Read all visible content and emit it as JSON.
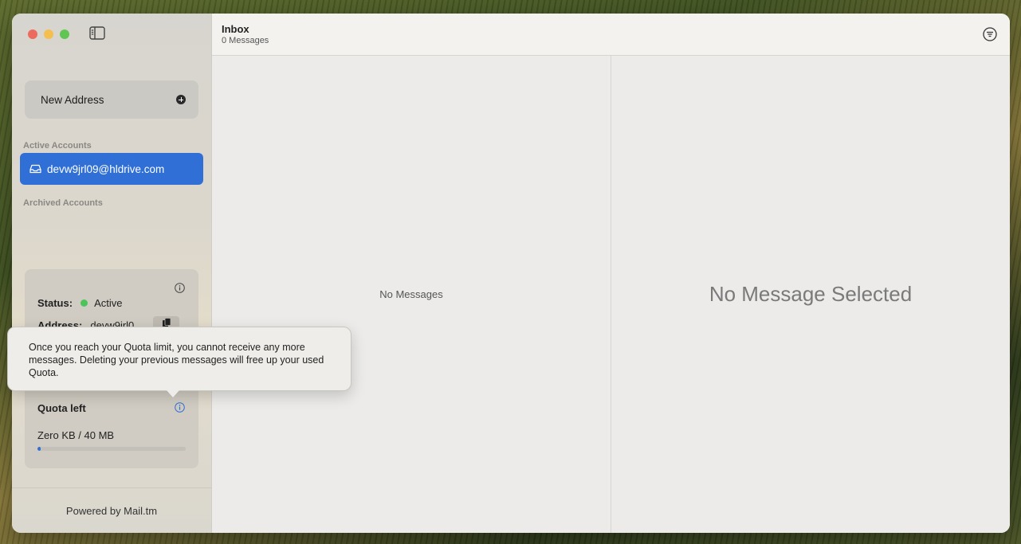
{
  "toolbar": {
    "title": "Inbox",
    "subtitle": "0 Messages"
  },
  "sidebar": {
    "new_address_label": "New Address",
    "active_section": "Active Accounts",
    "archived_section": "Archived Accounts",
    "accounts": [
      {
        "email": "devw9jrl09@hldrive.com",
        "selected": true
      }
    ],
    "footer": "Powered by Mail.tm"
  },
  "status_card": {
    "status_label": "Status:",
    "status_value": "Active",
    "address_label": "Address:",
    "address_value": "devw9jrl0",
    "quota_label": "Quota left",
    "quota_value": "Zero KB / 40 MB",
    "quota_used_fraction": 0.02
  },
  "tooltip": {
    "text": "Once you reach your Quota limit, you cannot receive any more messages. Deleting your previous messages will free up your used Quota."
  },
  "list_pane": {
    "empty_text": "No Messages"
  },
  "detail_pane": {
    "empty_text": "No Message Selected"
  },
  "colors": {
    "accent": "#2f6fd6",
    "status_active": "#4cc45a"
  }
}
